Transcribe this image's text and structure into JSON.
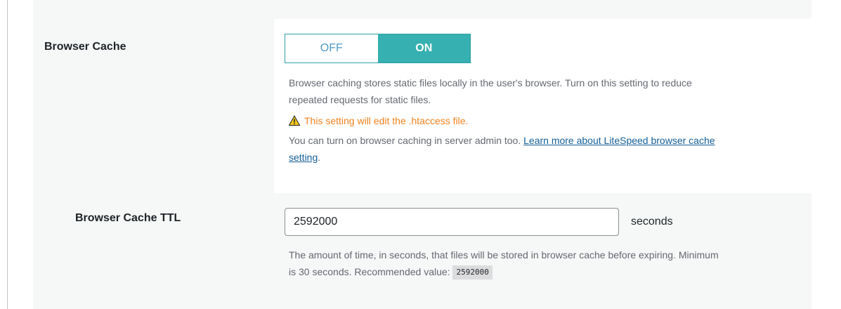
{
  "browser_cache": {
    "label": "Browser Cache",
    "toggle": {
      "off_label": "OFF",
      "on_label": "ON",
      "selected": "ON"
    },
    "description_line1": "Browser caching stores static files locally in the user's browser. Turn on this setting to reduce",
    "description_line2": "repeated requests for static files.",
    "warning": "This setting will edit the .htaccess file.",
    "note_prefix": "You can turn on browser caching in server admin too.",
    "link_text_part1": "Learn more about LiteSpeed browser cache",
    "link_text_part2": "setting",
    "note_suffix": "."
  },
  "browser_cache_ttl": {
    "label": "Browser Cache TTL",
    "input_value": "2592000",
    "unit": "seconds",
    "description_line1": "The amount of time, in seconds, that files will be stored in browser cache before expiring. Minimum",
    "description_line2_prefix": "is 30 seconds. Recommended value:",
    "recommended_value": "2592000"
  },
  "colors": {
    "toggle_on": "#36b0b0",
    "warning": "#f0821e",
    "link": "#135e96"
  }
}
